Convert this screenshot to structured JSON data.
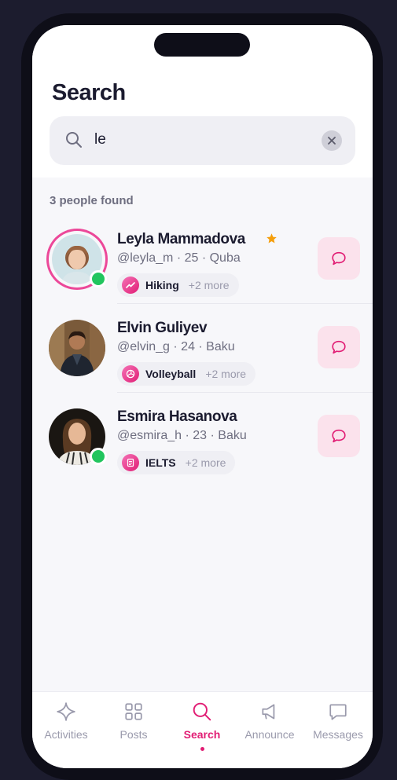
{
  "header": {
    "title": "Search"
  },
  "search": {
    "query": "le",
    "placeholder": ""
  },
  "results": {
    "count_label": "3 people found",
    "people": [
      {
        "name": "Leyla Mammadova",
        "meta": "@leyla_m · 25 · Quba",
        "tag": "Hiking",
        "more": "+2 more",
        "featured": true,
        "online": true
      },
      {
        "name": "Elvin Guliyev",
        "meta": "@elvin_g · 24 · Baku",
        "tag": "Volleyball",
        "more": "+2 more",
        "featured": false,
        "online": false
      },
      {
        "name": "Esmira Hasanova",
        "meta": "@esmira_h · 23 · Baku",
        "tag": "IELTS",
        "more": "+2 more",
        "featured": false,
        "online": true
      }
    ]
  },
  "tabs": [
    {
      "label": "Activities",
      "icon": "sparkle-icon",
      "active": false
    },
    {
      "label": "Posts",
      "icon": "grid-icon",
      "active": false
    },
    {
      "label": "Search",
      "icon": "search-icon",
      "active": true
    },
    {
      "label": "Announce",
      "icon": "megaphone-icon",
      "active": false
    },
    {
      "label": "Messages",
      "icon": "chat-icon",
      "active": false
    }
  ],
  "colors": {
    "accent": "#e11d74",
    "online": "#22c55e",
    "star": "#f59e0b",
    "background": "#f7f7fa"
  }
}
